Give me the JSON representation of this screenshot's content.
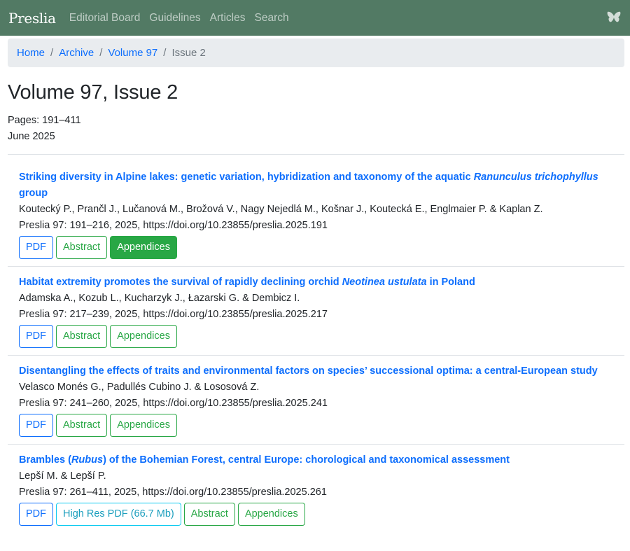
{
  "navbar": {
    "brand": "Preslia",
    "links": [
      "Editorial Board",
      "Guidelines",
      "Articles",
      "Search"
    ],
    "icon": "butterfly-icon",
    "bg_color": "#527a64"
  },
  "breadcrumb": {
    "items": [
      "Home",
      "Archive",
      "Volume 97"
    ],
    "active": "Issue 2",
    "separator": "/"
  },
  "issue": {
    "title": "Volume 97, Issue 2",
    "pages": "Pages: 191–411",
    "date": "June 2025"
  },
  "articles": [
    {
      "title_parts": [
        {
          "text": "Striking diversity in Alpine lakes: genetic variation, hybridization and taxonomy of the aquatic ",
          "italic": false
        },
        {
          "text": "Ranunculus trichophyllus",
          "italic": true
        },
        {
          "text": " group",
          "italic": false
        }
      ],
      "authors": "Koutecký P., Prančl J., Lučanová M., Brožová V., Nagy Nejedlá M., Košnar J., Koutecká E., Englmaier P. & Kaplan Z.",
      "citation": "Preslia 97: 191–216, 2025, https://doi.org/10.23855/preslia.2025.191",
      "buttons": [
        {
          "label": "PDF",
          "kind": "pdf"
        },
        {
          "label": "Abstract",
          "kind": "abs"
        },
        {
          "label": "Appendices",
          "kind": "app",
          "active": true
        }
      ]
    },
    {
      "title_parts": [
        {
          "text": "Habitat extremity promotes the survival of rapidly declining orchid ",
          "italic": false
        },
        {
          "text": "Neotinea ustulata",
          "italic": true
        },
        {
          "text": " in Poland",
          "italic": false
        }
      ],
      "authors": "Adamska A., Kozub L., Kucharzyk J., Łazarski G. & Dembicz I.",
      "citation": "Preslia 97: 217–239, 2025, https://doi.org/10.23855/preslia.2025.217",
      "buttons": [
        {
          "label": "PDF",
          "kind": "pdf"
        },
        {
          "label": "Abstract",
          "kind": "abs"
        },
        {
          "label": "Appendices",
          "kind": "app"
        }
      ]
    },
    {
      "title_parts": [
        {
          "text": "Disentangling the effects of traits and environmental factors on species’ successional optima: a central-European study",
          "italic": false
        }
      ],
      "authors": "Velasco Monés G., Padullés Cubino J. & Lososová Z.",
      "citation": "Preslia 97: 241–260, 2025, https://doi.org/10.23855/preslia.2025.241",
      "buttons": [
        {
          "label": "PDF",
          "kind": "pdf"
        },
        {
          "label": "Abstract",
          "kind": "abs"
        },
        {
          "label": "Appendices",
          "kind": "app"
        }
      ]
    },
    {
      "title_parts": [
        {
          "text": "Brambles (",
          "italic": false
        },
        {
          "text": "Rubus",
          "italic": true
        },
        {
          "text": ") of the Bohemian Forest, central Europe: chorological and taxonomical assessment",
          "italic": false
        }
      ],
      "authors": "Lepší M. & Lepší P.",
      "citation": "Preslia 97: 261–411, 2025, https://doi.org/10.23855/preslia.2025.261",
      "buttons": [
        {
          "label": "PDF",
          "kind": "pdf"
        },
        {
          "label": "High Res PDF (66.7 Mb)",
          "kind": "hires"
        },
        {
          "label": "Abstract",
          "kind": "abs"
        },
        {
          "label": "Appendices",
          "kind": "app"
        }
      ]
    }
  ]
}
